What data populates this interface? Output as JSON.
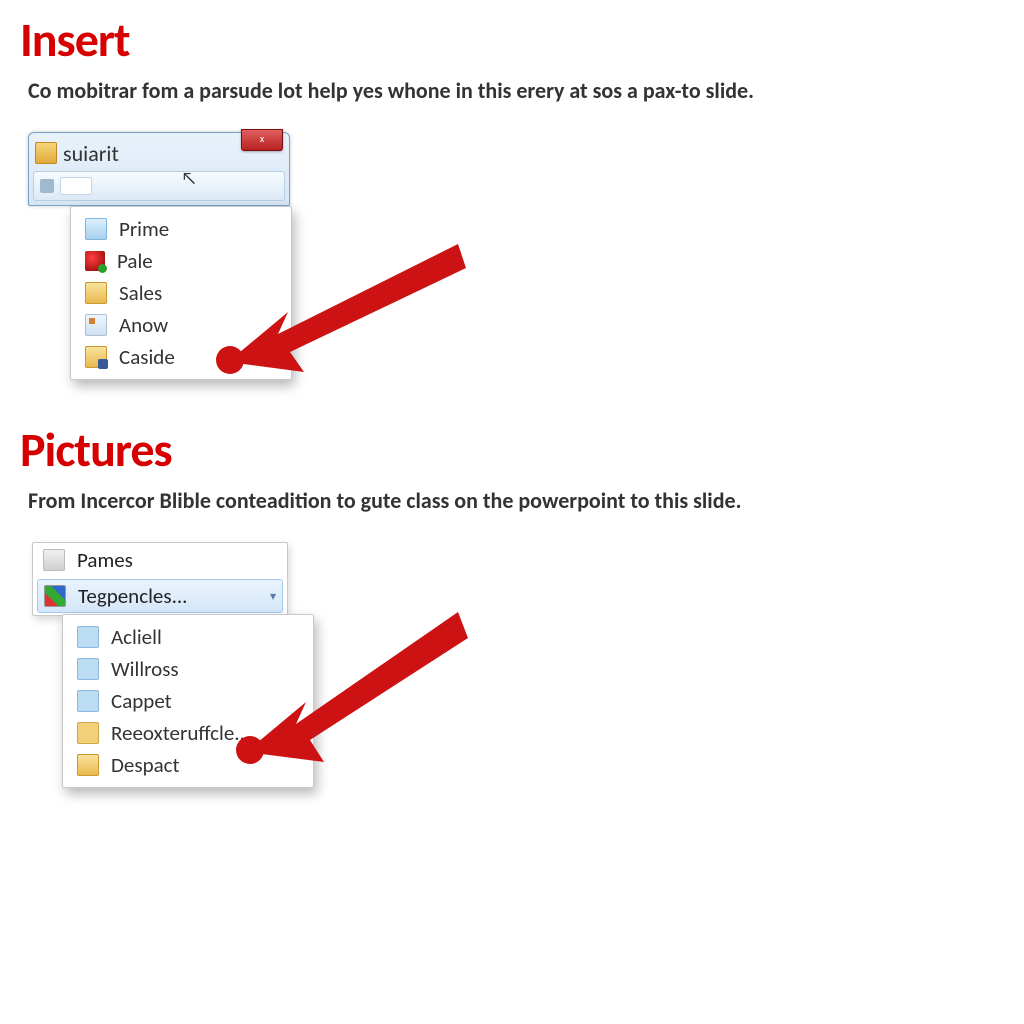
{
  "sections": {
    "insert": {
      "heading": "Insert",
      "description": "Co mobitrar fom a parsude lot help yes whone in this erery at sos a pax-to slide."
    },
    "pictures": {
      "heading": "Pictures",
      "description": "From Incercor Blible conteadition to gute class on the powerpoint to this slide."
    }
  },
  "figure1": {
    "window_title": "suiarit",
    "close_badge": "x",
    "menu": [
      {
        "label": "Prime",
        "icon": "picture"
      },
      {
        "label": "Pale",
        "icon": "reddot"
      },
      {
        "label": "Sales",
        "icon": "folder"
      },
      {
        "label": "Anow",
        "icon": "app"
      },
      {
        "label": "Caside",
        "icon": "folder-fb"
      }
    ]
  },
  "figure2": {
    "listbox": [
      {
        "label": "Pames",
        "icon": "winflag",
        "selected": false
      },
      {
        "label": "Tegpencles...",
        "icon": "multi",
        "selected": true,
        "has_submenu": true
      }
    ],
    "menu": [
      {
        "label": "Acliell",
        "icon": "cloud"
      },
      {
        "label": "Willross",
        "icon": "cloud"
      },
      {
        "label": "Cappet",
        "icon": "cloud"
      },
      {
        "label": "Reeoxteruffcle...",
        "icon": "cloud-y"
      },
      {
        "label": "Despact",
        "icon": "folder"
      }
    ]
  }
}
